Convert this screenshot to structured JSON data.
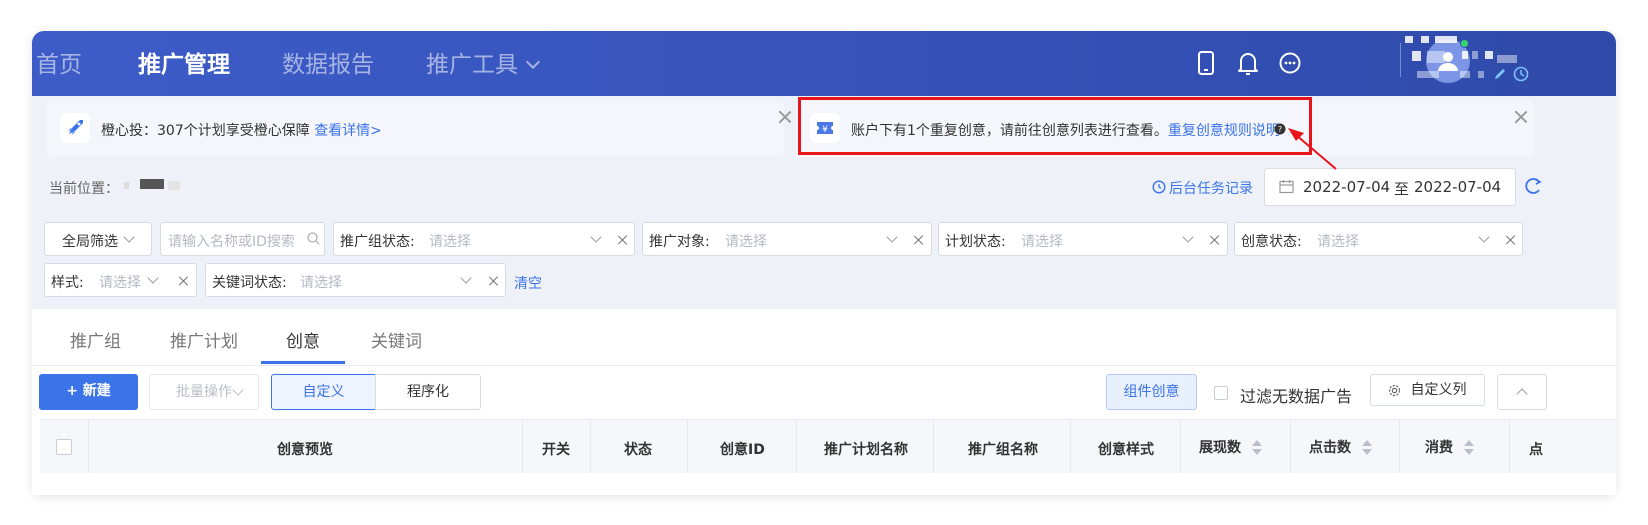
{
  "nav": {
    "home": "首页",
    "promo_mgmt": "推广管理",
    "data_report": "数据报告",
    "promo_tools": "推广工具"
  },
  "notice1": {
    "text": "橙心投：307个计划享受橙心保障",
    "link": "查看详情>"
  },
  "notice2": {
    "text": "账户下有1个重复创意，请前往创意列表进行查看。",
    "link": "重复创意规则说明"
  },
  "breadcrumb": {
    "label": "当前位置："
  },
  "task_link": "后台任务记录",
  "date_range": {
    "start": "2022-07-04",
    "sep": "至",
    "end": "2022-07-04"
  },
  "filters": {
    "global": "全局筛选",
    "search_placeholder": "请输入名称或ID搜索",
    "group_status": "推广组状态:",
    "target": "推广对象:",
    "plan_status": "计划状态:",
    "creative_status": "创意状态:",
    "style": "样式:",
    "keyword_status": "关键词状态:",
    "placeholder": "请选择",
    "clear": "清空"
  },
  "tabs": [
    "推广组",
    "推广计划",
    "创意",
    "关键词"
  ],
  "toolbar": {
    "new": "+ 新建",
    "batch": "批量操作",
    "custom": "自定义",
    "programmatic": "程序化",
    "component_creative": "组件创意",
    "filter_no_data": "过滤无数据广告",
    "custom_columns": "自定义列"
  },
  "table": {
    "headers": [
      "创意预览",
      "开关",
      "状态",
      "创意ID",
      "推广计划名称",
      "推广组名称",
      "创意样式",
      "展现数",
      "点击数",
      "消费",
      "点"
    ]
  },
  "colors": {
    "nav_bg": "#3552b9",
    "accent": "#3b74e8",
    "highlight_box": "#e8141a"
  }
}
